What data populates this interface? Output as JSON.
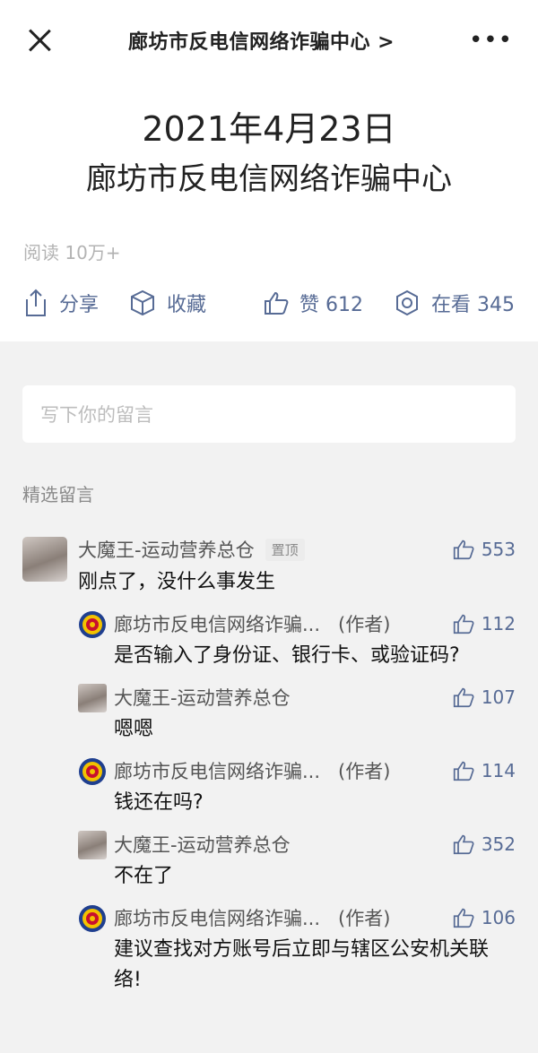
{
  "nav": {
    "title": "廊坊市反电信网络诈骗中心 >",
    "more": "•••"
  },
  "article": {
    "date": "2021年4月23日",
    "title": "廊坊市反电信网络诈骗中心",
    "read_label": "阅读 10万+"
  },
  "actions": {
    "share": "分享",
    "favorite": "收藏",
    "like": "赞 612",
    "watching": "在看 345"
  },
  "comment_input": {
    "placeholder": "写下你的留言"
  },
  "section_label": "精选留言",
  "comment": {
    "name": "大魔王-运动营养总仓",
    "pin": "置顶",
    "likes": "553",
    "text": "刚点了，没什么事发生"
  },
  "replies": [
    {
      "name": "廊坊市反电信网络诈骗...",
      "author": "(作者)",
      "likes": "112",
      "text": "是否输入了身份证、银行卡、或验证码?"
    },
    {
      "name": "大魔王-运动营养总仓",
      "author": "",
      "likes": "107",
      "text": "嗯嗯"
    },
    {
      "name": "廊坊市反电信网络诈骗...",
      "author": "(作者)",
      "likes": "114",
      "text": "钱还在吗?"
    },
    {
      "name": "大魔王-运动营养总仓",
      "author": "",
      "likes": "352",
      "text": "不在了"
    },
    {
      "name": "廊坊市反电信网络诈骗...",
      "author": "(作者)",
      "likes": "106",
      "text": "建议查找对方账号后立即与辖区公安机关联络!"
    }
  ],
  "colors": {
    "link": "#576b95",
    "muted": "#b3b3b3",
    "background": "#f2f2f2"
  }
}
